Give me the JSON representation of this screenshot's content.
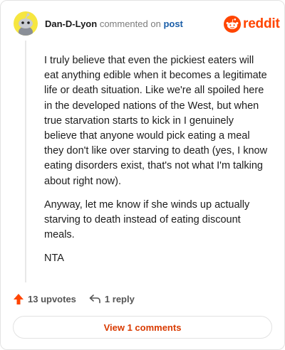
{
  "comment": {
    "username": "Dan-D-Lyon",
    "action": "commented on",
    "target": "post",
    "brand": "reddit",
    "paragraphs": [
      "I truly believe that even the pickiest eaters will eat anything edible when it becomes a legitimate life or death situation. Like we're all spoiled here in the developed nations of the West, but when true starvation starts to kick in I genuinely believe that anyone would pick eating a meal they don't like over starving to death (yes, I know eating disorders exist, that's not what I'm talking about right now).",
      "Anyway, let me know if she winds up actually starving to death instead of eating discount meals.",
      "NTA"
    ],
    "upvotes_label": "13 upvotes",
    "replies_label": "1 reply",
    "view_comments_label": "View 1 comments"
  },
  "icons": {
    "upvote": "upvote-arrow-icon",
    "reply": "reply-arrow-icon",
    "brand": "reddit-snoo-icon",
    "avatar": "snoo-avatar"
  },
  "colors": {
    "brand": "#ff4500",
    "link": "#1a5ea8",
    "view_button_text": "#d93a00",
    "avatar_bg": "#f6e640"
  }
}
